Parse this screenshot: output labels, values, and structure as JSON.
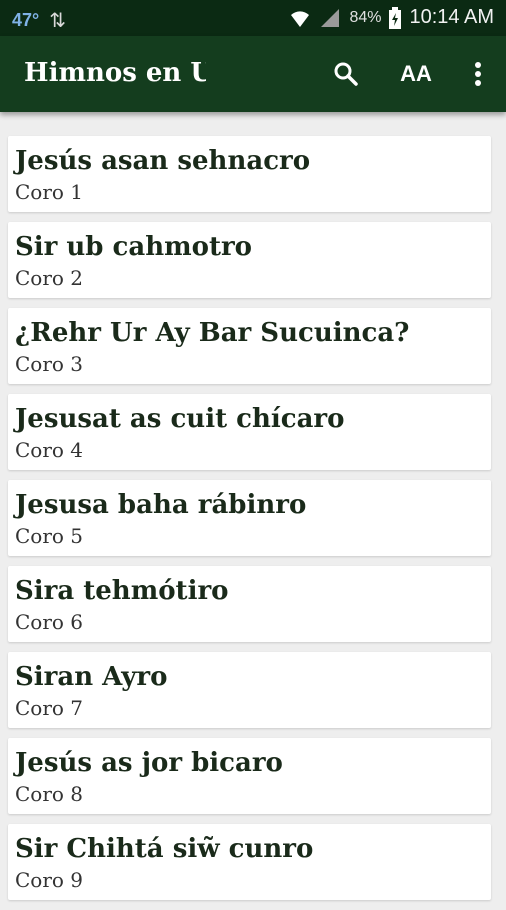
{
  "status": {
    "temperature": "47°",
    "battery": "84%",
    "time": "10:14 AM"
  },
  "appbar": {
    "title": "Himnos en Uw",
    "text_size_label": "AA"
  },
  "hymns": [
    {
      "title": "Jesús asan sehnacro",
      "coro": "Coro 1"
    },
    {
      "title": "Sir ub cahmotro",
      "coro": "Coro 2"
    },
    {
      "title": "¿Rehr Ur Ay Bar Sucuinca?",
      "coro": "Coro 3"
    },
    {
      "title": "Jesusat as cuit chícaro",
      "coro": "Coro 4"
    },
    {
      "title": "Jesusa baha rábinro",
      "coro": "Coro 5"
    },
    {
      "title": "Sira tehmótiro",
      "coro": "Coro 6"
    },
    {
      "title": "Siran Ayro",
      "coro": "Coro 7"
    },
    {
      "title": "Jesús as jor bicaro",
      "coro": "Coro 8"
    },
    {
      "title": "Sir Chihtá siw̃ cunro",
      "coro": "Coro 9"
    }
  ]
}
